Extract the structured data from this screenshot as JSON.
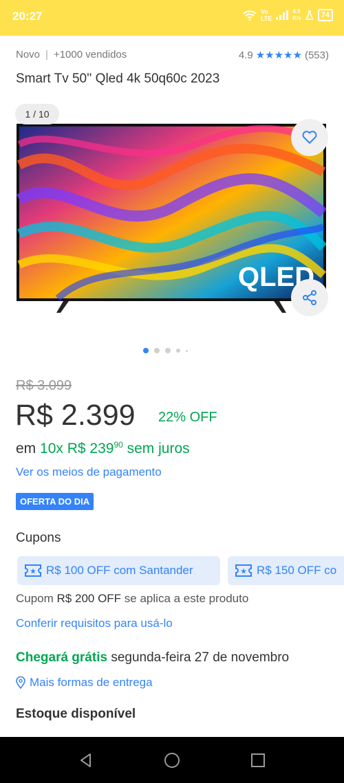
{
  "status_bar": {
    "time": "20:27",
    "network_top": "Vo",
    "network_bottom": "LTE",
    "speed_top": "4.9",
    "speed_bottom": "K/s",
    "battery": "74"
  },
  "product": {
    "condition": "Novo",
    "sold": "+1000 vendidos",
    "rating": "4.9",
    "reviews": "(553)",
    "title": "Smart Tv 50'' Qled 4k 50q60c 2023"
  },
  "gallery": {
    "counter": "1 / 10",
    "tv_logo": "QLED"
  },
  "pricing": {
    "old_price": "R$ 3.099",
    "price": "R$ 2.399",
    "discount": "22% OFF",
    "installments_prefix": "em ",
    "installments_green": "10x R$ 239",
    "installments_cents": "90",
    "installments_suffix": " sem juros",
    "payment_link": "Ver os meios de pagamento",
    "badge": "OFERTA DO DIA"
  },
  "coupons": {
    "title": "Cupons",
    "items": [
      {
        "label": "R$ 100 OFF com Santander"
      },
      {
        "label": "R$ 150 OFF co"
      }
    ],
    "note_prefix": "Cupom ",
    "note_amount": "R$ 200 OFF",
    "note_suffix": " se aplica a este produto",
    "requirements_link": "Conferir requisitos para usá-lo"
  },
  "shipping": {
    "free_label": "Chegará grátis",
    "date": " segunda-feira 27 de novembro",
    "more_options": "Mais formas de entrega"
  },
  "stock": {
    "title": "Estoque disponível"
  },
  "colors": {
    "header": "#ffe14d",
    "accent": "#3483fa",
    "green": "#00a650"
  }
}
